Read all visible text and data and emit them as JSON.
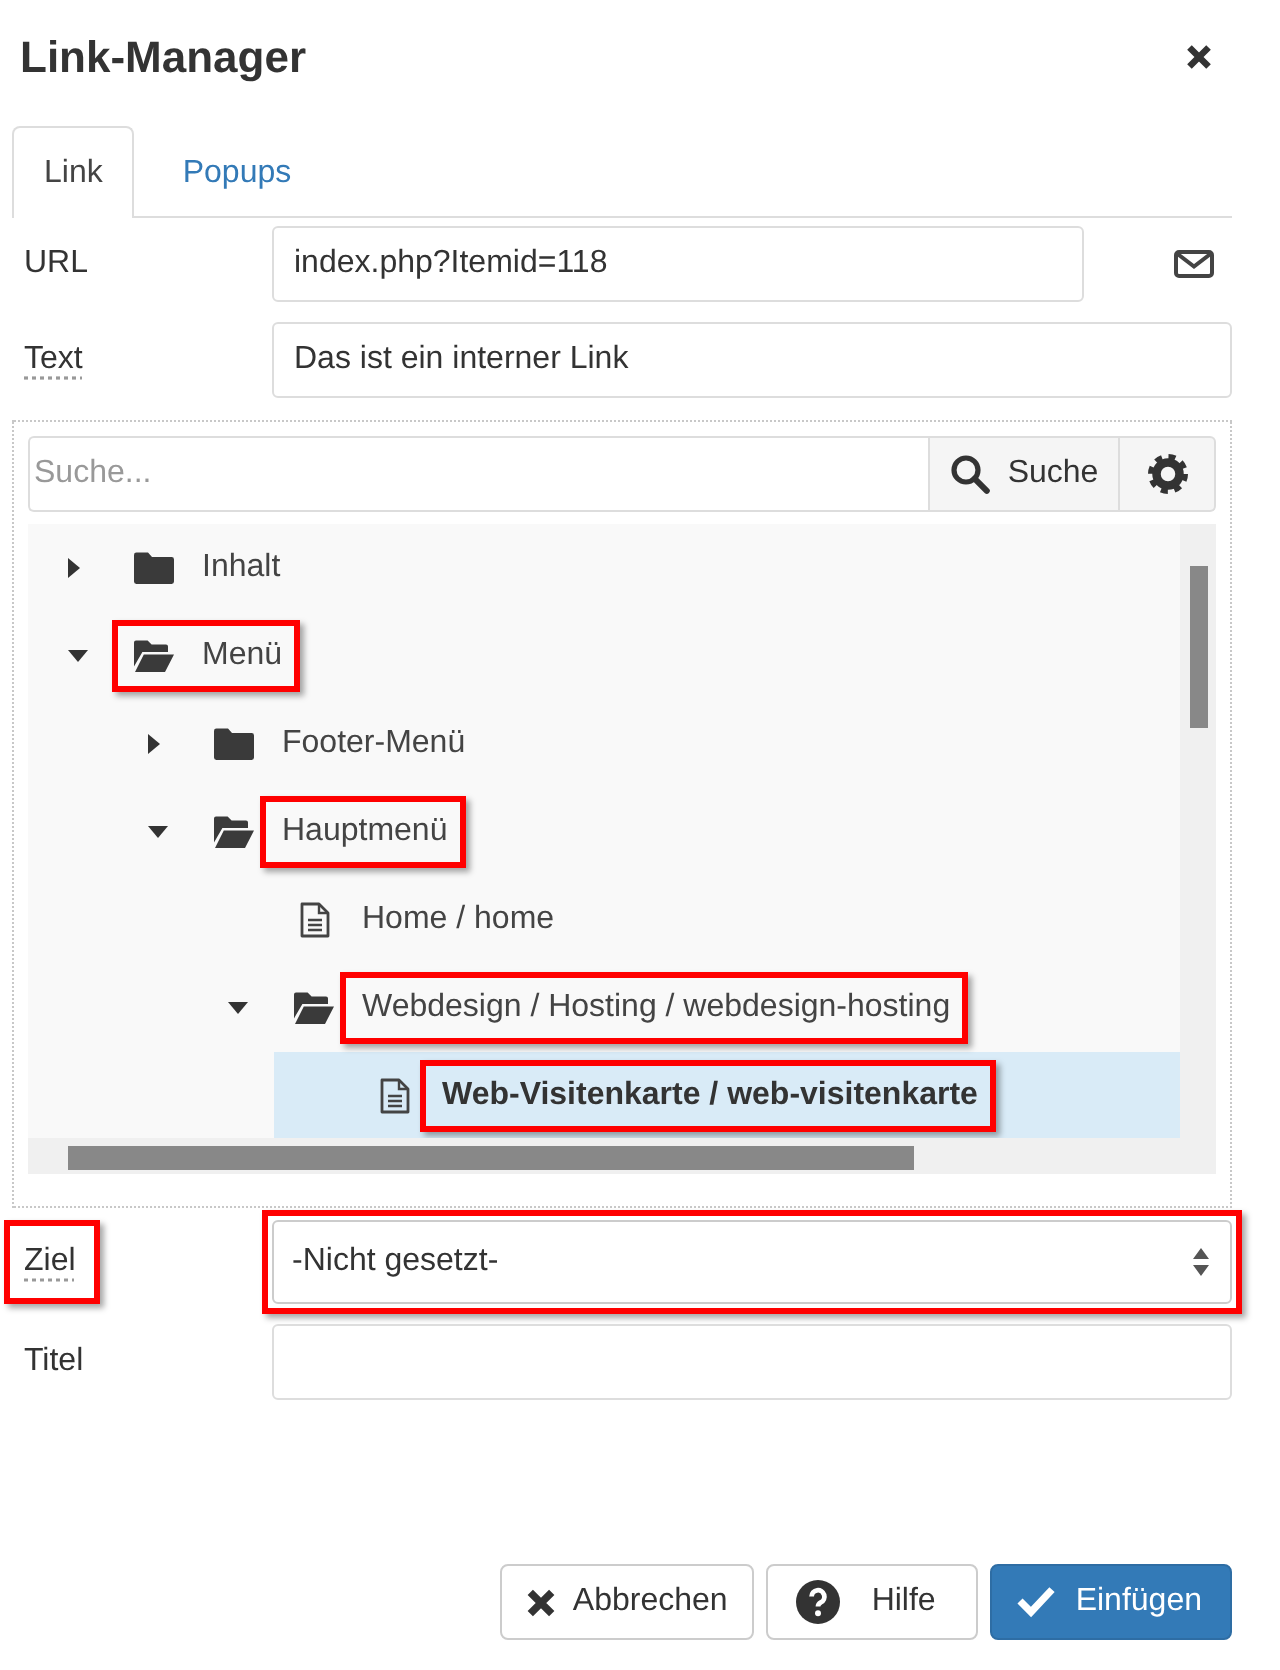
{
  "window": {
    "title": "Link-Manager"
  },
  "tabs": [
    {
      "label": "Link",
      "selected": true
    },
    {
      "label": "Popups",
      "selected": false
    }
  ],
  "link_fields": [
    {
      "kind": "url",
      "label": "URL",
      "tooltip": false,
      "value": "index.php?Itemid=118"
    },
    {
      "kind": "text",
      "label": "Text",
      "tooltip": true,
      "value": "Das ist ein interner Link"
    }
  ],
  "browser": {
    "search": {
      "placeholder": "Suche...",
      "button": "Suche"
    },
    "tree": [
      {
        "kind": "folder",
        "label": "Inhalt",
        "expanded": false,
        "selected": false,
        "highlighted": false,
        "icon_highlighted": false
      },
      {
        "kind": "folder",
        "label": "Menü",
        "expanded": true,
        "selected": false,
        "highlighted": true,
        "icon_highlighted": true,
        "children": [
          {
            "kind": "folder",
            "label": "Footer-Menü",
            "expanded": false,
            "selected": false,
            "highlighted": false,
            "icon_highlighted": false
          },
          {
            "kind": "folder",
            "label": "Hauptmenü",
            "expanded": true,
            "selected": false,
            "highlighted": true,
            "icon_highlighted": false,
            "children": [
              {
                "kind": "page",
                "label": "Home / home",
                "selected": false,
                "highlighted": false,
                "icon_highlighted": false
              },
              {
                "kind": "folder",
                "label": "Webdesign / Hosting / webdesign-hosting",
                "expanded": true,
                "selected": false,
                "highlighted": true,
                "icon_highlighted": false,
                "children": [
                  {
                    "kind": "page",
                    "label": "Web-Visitenkarte / web-visitenkarte",
                    "selected": true,
                    "highlighted": true,
                    "icon_highlighted": false
                  }
                ]
              }
            ]
          }
        ]
      }
    ]
  },
  "target_fields": [
    {
      "kind": "select",
      "label": "Ziel",
      "tooltip": true,
      "label_highlighted": true,
      "value": "-Nicht gesetzt-",
      "highlighted": true
    },
    {
      "kind": "text",
      "label": "Titel",
      "tooltip": false,
      "label_highlighted": false,
      "highlighted": false
    }
  ],
  "buttons": [
    {
      "kind": "cancel",
      "label": "Abbrechen"
    },
    {
      "kind": "help",
      "label": "Hilfe"
    },
    {
      "kind": "primary",
      "label": "Einfügen"
    }
  ]
}
